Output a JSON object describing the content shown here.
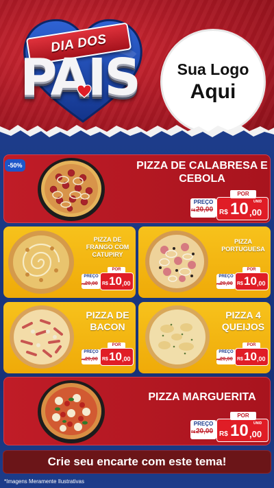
{
  "header": {
    "ribbon_text": "DIA DOS",
    "title_text": "PAIS",
    "logo_line1": "Sua Logo",
    "logo_line2": "Aqui"
  },
  "colors": {
    "brand_red": "#b01b27",
    "card_yellow": "#f7c21c",
    "card_red": "#c01c27",
    "background_blue": "#1d3c8a",
    "cta_bg": "#6b1518"
  },
  "discount_badge": "-50%",
  "price_labels": {
    "preco": "PREÇO",
    "por": "POR",
    "currency": "R$",
    "unid": "UNID"
  },
  "products": [
    {
      "name": "PIZZA DE CALABRESA E CEBOLA",
      "old_price": "20,00",
      "old_prefix": "R$",
      "price_int": "10",
      "price_cents": ",00",
      "pizza_icon": "calabresa-pizza"
    },
    {
      "name": "PIZZA DE FRANGO COM CATUPIRY",
      "old_price": "20,00",
      "old_prefix": "R$",
      "price_int": "10",
      "price_cents": ",00",
      "pizza_icon": "frango-pizza"
    },
    {
      "name": "PIZZA PORTUGUESA",
      "old_price": "20,00",
      "old_prefix": "R$",
      "price_int": "10",
      "price_cents": ",00",
      "pizza_icon": "portuguesa-pizza"
    },
    {
      "name": "PIZZA DE BACON",
      "old_price": "20,00",
      "old_prefix": "R$",
      "price_int": "10",
      "price_cents": ",00",
      "pizza_icon": "bacon-pizza"
    },
    {
      "name": "PIZZA 4 QUEIJOS",
      "old_price": "20,00",
      "old_prefix": "R$",
      "price_int": "10",
      "price_cents": ",00",
      "pizza_icon": "queijos-pizza"
    },
    {
      "name": "PIZZA MARGUERITA",
      "old_price": "20,00",
      "old_prefix": "R$",
      "price_int": "10",
      "price_cents": ",00",
      "pizza_icon": "marguerita-pizza"
    }
  ],
  "cta_text": "Crie seu encarte com este tema!",
  "footnote": "*Imagens Meramente Ilustrativas"
}
